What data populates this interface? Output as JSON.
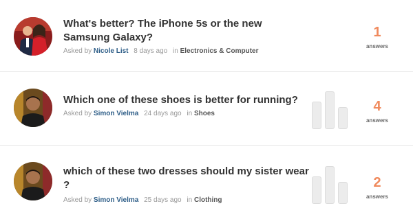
{
  "questions": [
    {
      "title": "What's better? The iPhone 5s or the new Samsung Galaxy?",
      "asked_by_label": "Asked by",
      "user": "Nicole List",
      "time": "8 days ago",
      "in_label": "in",
      "category": "Electronics & Computer",
      "answers_count": "1",
      "answers_label": "answers"
    },
    {
      "title": "Which one of these shoes is better for running?",
      "asked_by_label": "Asked by",
      "user": "Simon Vielma",
      "time": "24 days ago",
      "in_label": "in",
      "category": "Shoes",
      "answers_count": "4",
      "answers_label": "answers"
    },
    {
      "title": "which of these two dresses should my sister wear ?",
      "asked_by_label": "Asked by",
      "user": "Simon Vielma",
      "time": "25 days ago",
      "in_label": "in",
      "category": "Clothing",
      "answers_count": "2",
      "answers_label": "answers"
    }
  ],
  "colors": {
    "accent": "#f08a5d",
    "user_link": "#2d5d87"
  }
}
